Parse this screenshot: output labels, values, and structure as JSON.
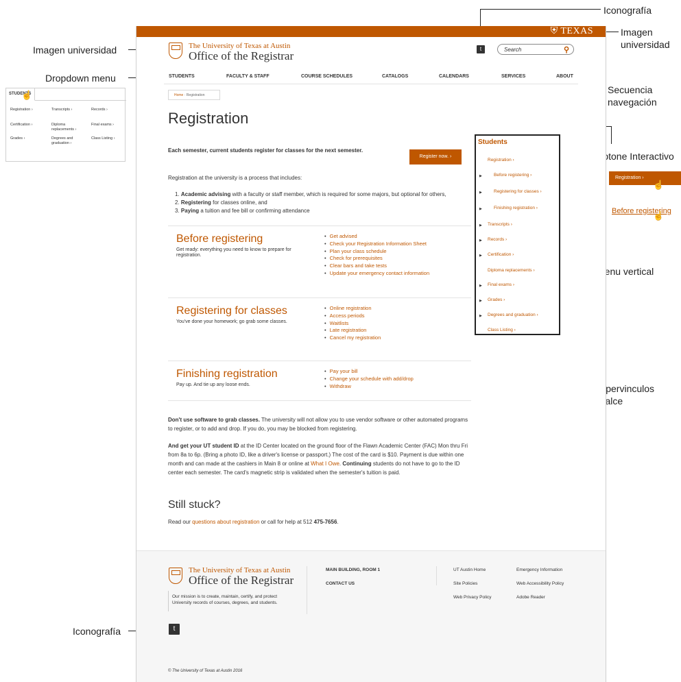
{
  "annotations": {
    "icon_top": "Iconografía",
    "brand_right": "Imagen universidad",
    "brand_left": "Imagen universidad",
    "dropdown": "Dropdown menu",
    "breadcrumb": "Secuencia navegación",
    "buttons": "Botone Interactivo",
    "vmenu": "Menu vertical",
    "links": "Hipervinculos realce",
    "icon_bottom": "Iconografía"
  },
  "header": {
    "texas": "TEXAS",
    "univ": "The University of Texas at Austin",
    "office": "Office of the Registrar",
    "search_placeholder": "Search"
  },
  "nav": [
    "STUDENTS",
    "FACULTY & STAFF",
    "COURSE SCHEDULES",
    "CATALOGS",
    "CALENDARS",
    "SERVICES",
    "ABOUT"
  ],
  "breadcrumb": {
    "home": "Home",
    "current": "Registration"
  },
  "main": {
    "title": "Registration",
    "lead": "Each semester, current students register for classes for the next semester.",
    "register_button": "Register now.",
    "intro": "Registration at the university is a process that includes:",
    "steps": [
      {
        "b": "Academic advising",
        "t": " with a faculty or staff member, which is required for some majors, but optional for others,"
      },
      {
        "b": "Registering",
        "t": " for classes online, and"
      },
      {
        "b": "Paying",
        "t": " a tuition and fee bill or confirming attendance"
      }
    ],
    "sections": [
      {
        "title": "Before registering",
        "sub": "Get ready: everything you need to know to prepare for registration.",
        "links": [
          "Get advised",
          "Check your Registration Information Sheet",
          "Plan your class schedule",
          "Check for prerequisites",
          "Clear bars and take tests",
          "Update your emergency contact information"
        ]
      },
      {
        "title": "Registering for classes",
        "sub": "You've done your homework; go grab some classes.",
        "links": [
          "Online registration",
          "Access periods",
          "Waitlists",
          "Late registration",
          "Cancel my registration"
        ]
      },
      {
        "title": "Finishing registration",
        "sub": "Pay up. And tie up any loose ends.",
        "links": [
          "Pay your bill",
          "Change your schedule with add/drop",
          "Withdraw"
        ]
      }
    ],
    "software_b": "Don't use software to grab classes.",
    "software_t": " The university will not allow you to use vendor software or other automated programs to register, or to add and drop. If you do, you may be blocked from registering.",
    "id_b": "And get your UT student ID",
    "id_t": " at the ID Center located on the ground floor of the Flawn Academic Center (FAC) Mon thru Fri from 8a to 6p. (Bring a photo ID, like a driver's license or passport.) The cost of the card is $10. Payment is due within one month and can made at the cashiers in Main 8 or online at ",
    "id_link": "What I Owe",
    "id_t2": ". ",
    "id_b2": "Continuing",
    "id_t3": " students do not have to go to the ID center each semester. The card's magnetic strip is validated when the semester's tuition is paid.",
    "stuck": "Still stuck?",
    "stuck_t1": "Read our ",
    "stuck_link": "questions about registration",
    "stuck_t2": " or call for help at 512 ",
    "stuck_phone": "475-7656",
    "stuck_t3": "."
  },
  "sidebar": {
    "heading": "Students",
    "items": [
      "Registration",
      "Before registering",
      "Registering for classes",
      "Finishing registration",
      "Transcripts",
      "Records",
      "Certification",
      "Diploma replacements",
      "Final exams",
      "Grades",
      "Degrees and graduation",
      "Class Listing"
    ]
  },
  "callouts": {
    "button": "Registration",
    "link": "Before registering"
  },
  "dropdown": {
    "tab": "STUDENTS",
    "items": [
      "Registration",
      "Transcripts",
      "Records",
      "Certification",
      "Diploma replacements",
      "Final exams",
      "Grades",
      "Degrees and graduation",
      "Class Listing"
    ]
  },
  "footer": {
    "univ": "The University of Texas at Austin",
    "office": "Office of the Registrar",
    "mission": "Our mission is to create, maintain, certify, and protect University records of courses, degrees, and students.",
    "main_building": "MAIN BUILDING, ROOM 1",
    "contact": "CONTACT US",
    "links": [
      "UT Austin Home",
      "Emergency Information",
      "Site Policies",
      "Web Accessibility Policy",
      "Web Privacy Policy",
      "Adobe Reader"
    ],
    "copyright": "© The University of Texas at Austin 2016"
  }
}
